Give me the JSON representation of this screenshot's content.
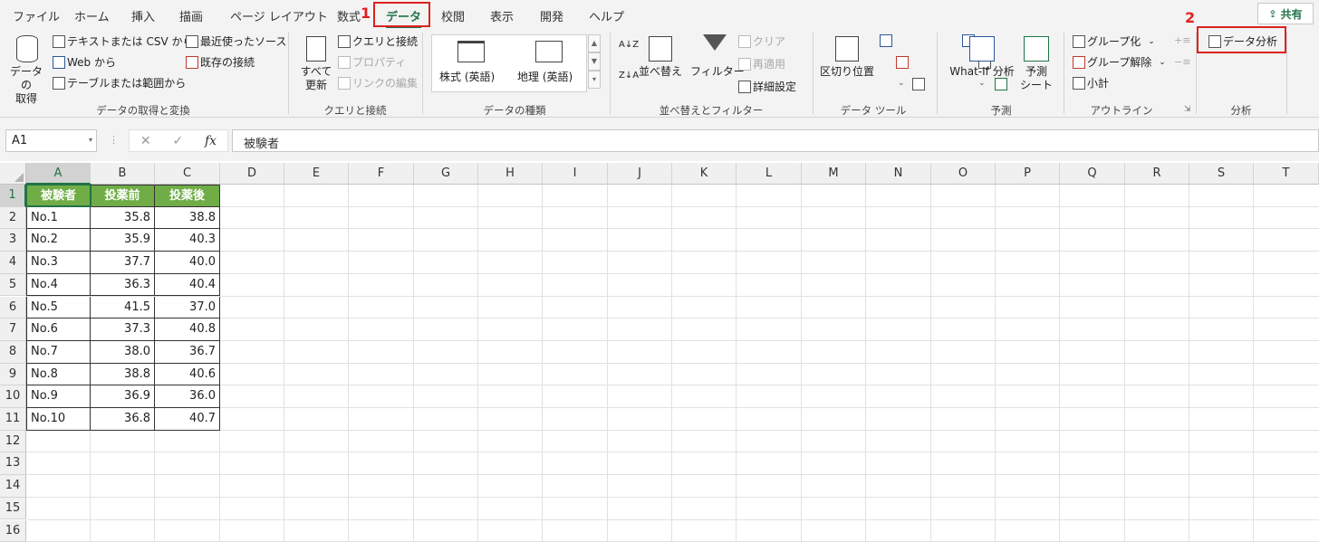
{
  "tabs": [
    "ファイル",
    "ホーム",
    "挿入",
    "描画",
    "ページ レイアウト",
    "数式",
    "データ",
    "校閲",
    "表示",
    "開発",
    "ヘルプ"
  ],
  "active_tab": "データ",
  "markers": {
    "step1": "1",
    "step2": "2"
  },
  "share_label": "共有",
  "ribbon": {
    "get_data": {
      "big_button": "データの\n取得",
      "items": [
        "テキストまたは CSV から",
        "Web から",
        "テーブルまたは範囲から",
        "最近使ったソース",
        "既存の接続"
      ],
      "label": "データの取得と変換"
    },
    "queries": {
      "big_button": "すべて\n更新",
      "items": [
        "クエリと接続",
        "プロパティ",
        "リンクの編集"
      ],
      "label": "クエリと接続"
    },
    "datatypes": {
      "items": [
        "株式 (英語)",
        "地理 (英語)"
      ],
      "label": "データの種類"
    },
    "sort": {
      "sort_button": "並べ替え",
      "filter_button": "フィルター",
      "items": [
        "クリア",
        "再適用",
        "詳細設定"
      ],
      "label": "並べ替えとフィルター"
    },
    "tools": {
      "big_button": "区切り位置",
      "label": "データ ツール"
    },
    "forecast": {
      "whatif": "What-If 分析",
      "sheet": "予測\nシート",
      "label": "予測"
    },
    "outline": {
      "items": [
        "グループ化",
        "グループ解除",
        "小計"
      ],
      "label": "アウトライン"
    },
    "analysis": {
      "button": "データ分析",
      "label": "分析"
    }
  },
  "formula_bar": {
    "name_box": "A1",
    "fx": "fx",
    "value": "被験者"
  },
  "sheet": {
    "columns": [
      "A",
      "B",
      "C",
      "D",
      "E",
      "F",
      "G",
      "H",
      "I",
      "J",
      "K",
      "L",
      "M",
      "N",
      "O",
      "P",
      "Q",
      "R",
      "S",
      "T"
    ],
    "rows": [
      "1",
      "2",
      "3",
      "4",
      "5",
      "6",
      "7",
      "8",
      "9",
      "10",
      "11",
      "12",
      "13",
      "14",
      "15",
      "16"
    ],
    "header": [
      "被験者",
      "投薬前",
      "投薬後"
    ],
    "data": [
      [
        "No.1",
        "35.8",
        "38.8"
      ],
      [
        "No.2",
        "35.9",
        "40.3"
      ],
      [
        "No.3",
        "37.7",
        "40.0"
      ],
      [
        "No.4",
        "36.3",
        "40.4"
      ],
      [
        "No.5",
        "41.5",
        "37.0"
      ],
      [
        "No.6",
        "37.3",
        "40.8"
      ],
      [
        "No.7",
        "38.0",
        "36.7"
      ],
      [
        "No.8",
        "38.8",
        "40.6"
      ],
      [
        "No.9",
        "36.9",
        "36.0"
      ],
      [
        "No.10",
        "36.8",
        "40.7"
      ]
    ]
  },
  "colors": {
    "accent": "#217346",
    "header_fill": "#70ad47",
    "highlight": "#e02020"
  }
}
